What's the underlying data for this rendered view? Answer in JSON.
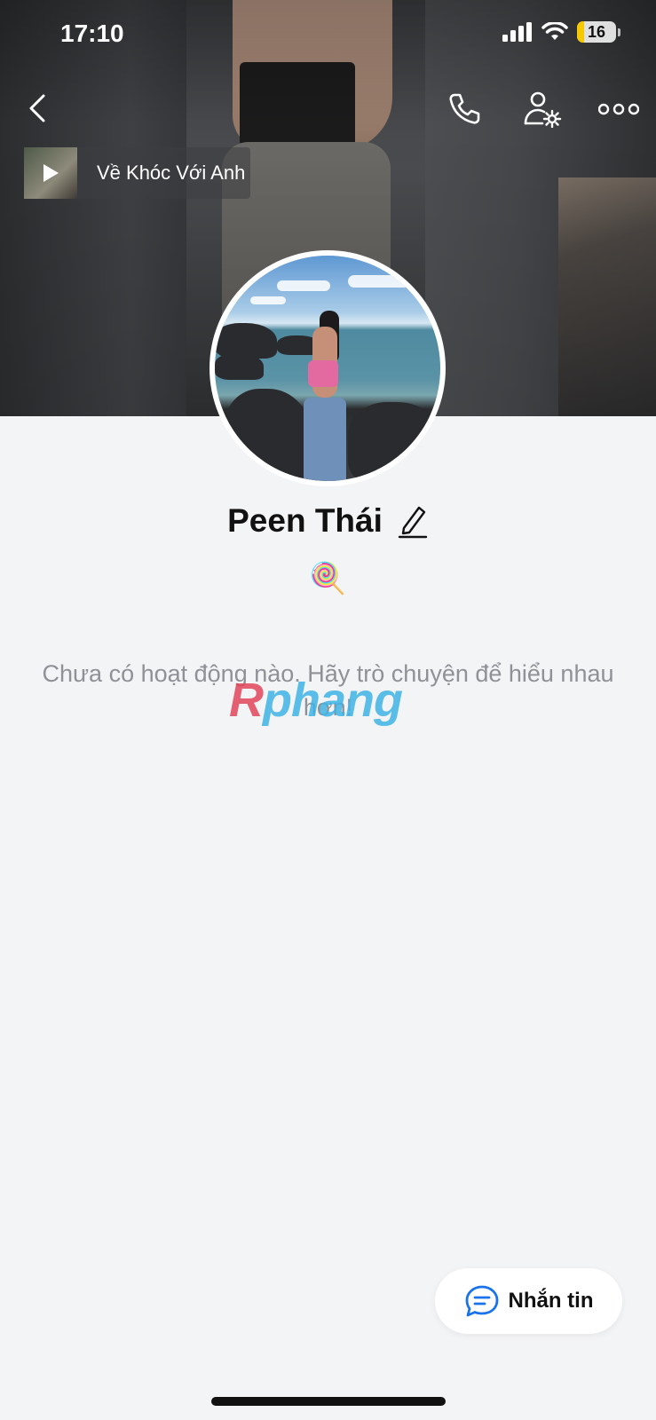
{
  "status_bar": {
    "time": "17:10",
    "battery_level": "16",
    "icons": [
      "cellular-signal-icon",
      "wifi-icon",
      "battery-icon"
    ]
  },
  "header": {
    "icons": {
      "back": "chevron-left-icon",
      "call": "phone-icon",
      "settings": "profile-settings-icon",
      "more": "more-icon"
    }
  },
  "music": {
    "title": "Về Khóc Với Anh",
    "icon": "play-icon"
  },
  "profile": {
    "name": "Peen Thái",
    "bio": "🍭",
    "edit_icon": "pencil-icon"
  },
  "feed": {
    "empty_message": "Chưa có hoạt động nào. Hãy trò chuyện để hiểu nhau hơn!"
  },
  "watermark": {
    "part1": "R",
    "part2": "phang"
  },
  "actions": {
    "message_label": "Nhắn tin",
    "message_icon": "chat-bubble-icon"
  },
  "colors": {
    "background": "#f3f4f6",
    "accent": "#1a73e8",
    "text_primary": "#111111",
    "text_muted": "#8e9196"
  }
}
